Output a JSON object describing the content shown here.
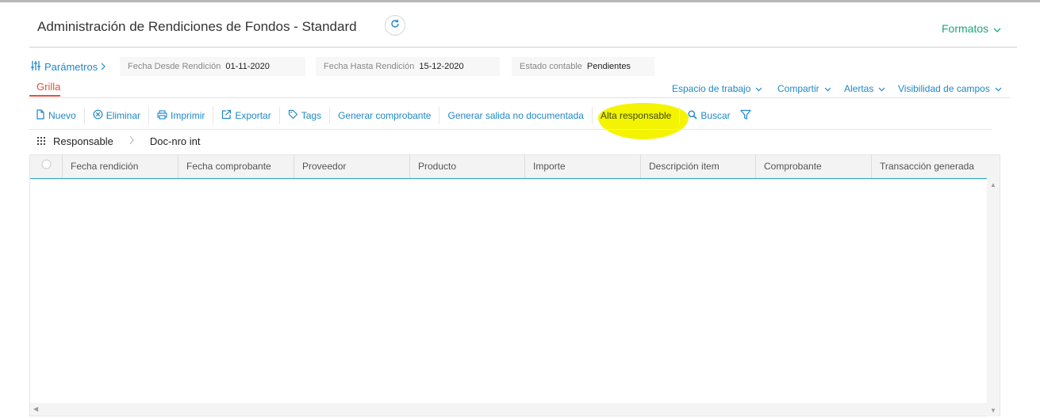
{
  "header": {
    "title": "Administración de Rendiciones de Fondos - Standard",
    "formatos_label": "Formatos"
  },
  "params": {
    "label": "Parámetros",
    "filters": [
      {
        "label": "Fecha Desde Rendición",
        "value": "01-11-2020"
      },
      {
        "label": "Fecha Hasta Rendición",
        "value": "15-12-2020"
      },
      {
        "label": "Estado contable",
        "value": "Pendientes"
      }
    ]
  },
  "tabs": {
    "active": "Grilla"
  },
  "right_menu": [
    "Espacio de trabajo",
    "Compartir",
    "Alertas",
    "Visibilidad de campos"
  ],
  "toolbar": {
    "nuevo": "Nuevo",
    "eliminar": "Eliminar",
    "imprimir": "Imprimir",
    "exportar": "Exportar",
    "tags": "Tags",
    "generar_comprobante": "Generar comprobante",
    "generar_salida": "Generar salida no documentada",
    "alta_responsable": "Alta responsable",
    "buscar": "Buscar"
  },
  "grouping": [
    "Responsable",
    "Doc-nro int"
  ],
  "grid": {
    "columns": [
      "Fecha rendición",
      "Fecha comprobante",
      "Proveedor",
      "Producto",
      "Importe",
      "Descripción item",
      "Comprobante",
      "Transacción generada"
    ],
    "rows": []
  },
  "colors": {
    "accent_blue": "#1e88c8",
    "green": "#1aa67a",
    "tab_red": "#e0533f",
    "highlight": "#f4f400"
  }
}
